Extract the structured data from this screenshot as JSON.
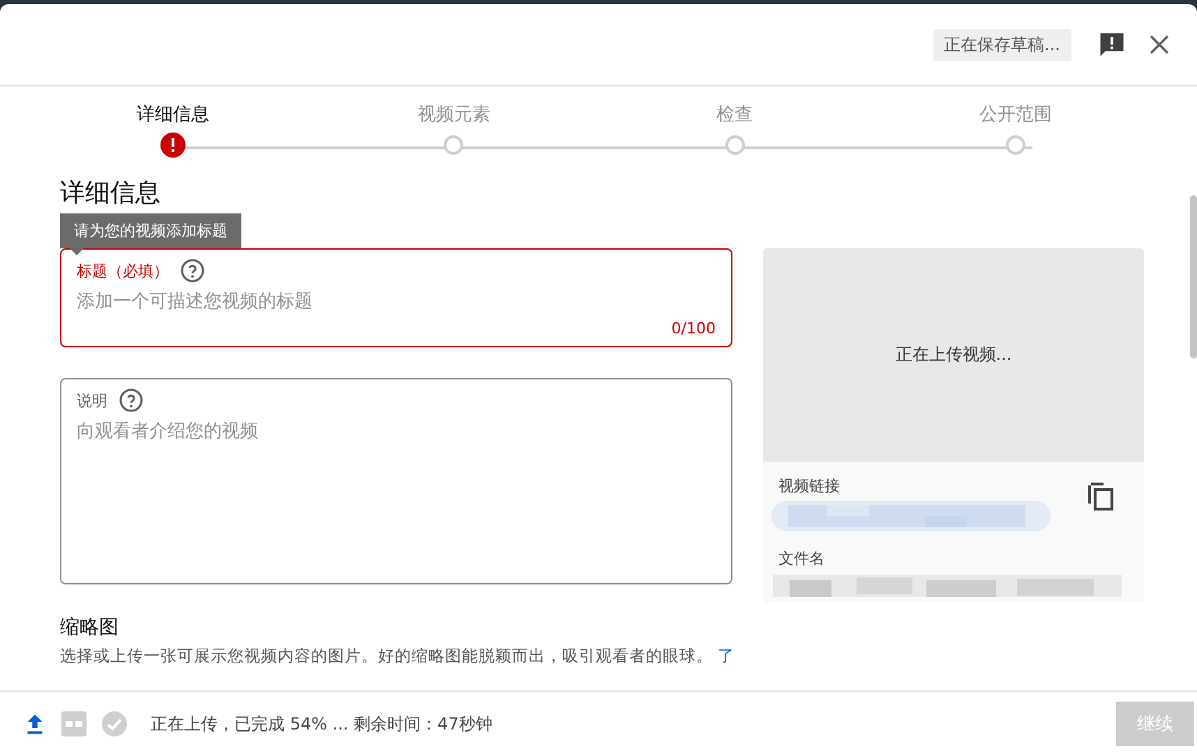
{
  "header": {
    "save_status": "正在保存草稿..."
  },
  "steps": [
    {
      "label": "详细信息",
      "selected": true,
      "error": true
    },
    {
      "label": "视频元素",
      "selected": false,
      "error": false
    },
    {
      "label": "检查",
      "selected": false,
      "error": false
    },
    {
      "label": "公开范围",
      "selected": false,
      "error": false
    }
  ],
  "heading": "详细信息",
  "tooltip": "请为您的视频添加标题",
  "fields": [
    {
      "label": "标题（必填）",
      "placeholder": "添加一个可描述您视频的标题",
      "counter": "0/100",
      "error": true
    },
    {
      "label": "说明",
      "placeholder": "向观看者介绍您的视频",
      "error": false
    }
  ],
  "thumbnail": {
    "title": "缩略图",
    "description": "选择或上传一张可展示您视频内容的图片。好的缩略图能脱颖而出，吸引观看者的眼球。",
    "link": "了"
  },
  "preview": {
    "status": "正在上传视频...",
    "link_label": "视频链接",
    "filename_label": "文件名"
  },
  "footer": {
    "status": "正在上传，已完成 54% ... 剩余时间：47秒钟",
    "continue": {
      "label": "继续",
      "disabled": true
    }
  }
}
